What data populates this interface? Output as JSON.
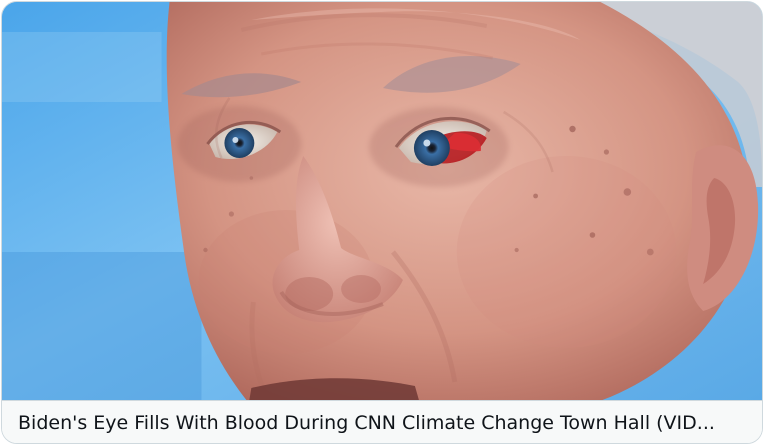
{
  "card": {
    "caption": "Biden's Eye Fills With Blood During CNN Climate Change Town Hall (VID..."
  },
  "media": {
    "subject": "close-up-face-photo"
  },
  "colors": {
    "background_blue": "#6fb3ea",
    "skin": "#d79b8e",
    "hair": "#d9dde2",
    "iris": "#2b5580",
    "blood": "#b71d22",
    "caption_bg": "#f7f9f9",
    "border": "#cfd9de",
    "text": "#0f1419"
  }
}
